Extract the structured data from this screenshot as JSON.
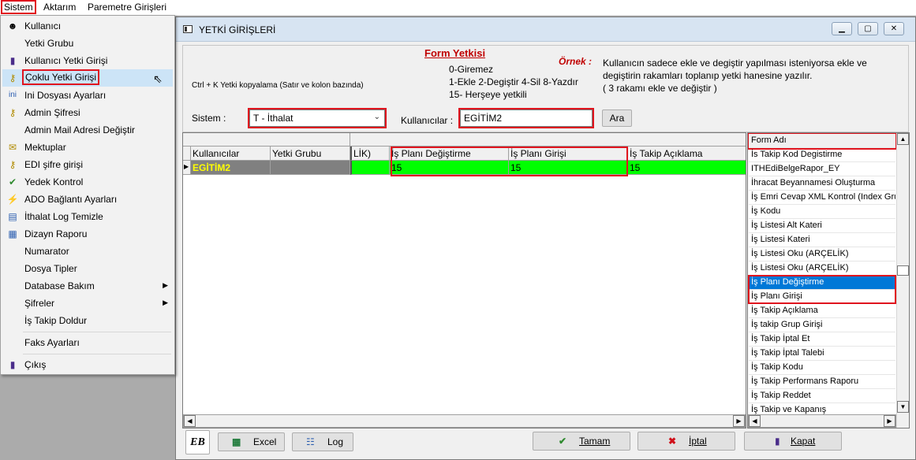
{
  "menubar": {
    "items": [
      "Sistem",
      "Aktarım",
      "Paremetre Girişleri"
    ]
  },
  "menu": {
    "items": [
      {
        "label": "Kullanıcı",
        "icon": "user-icon"
      },
      {
        "label": "Yetki Grubu",
        "icon": ""
      },
      {
        "label": "Kullanıcı Yetki Girişi",
        "icon": "door-icon"
      },
      {
        "label": "Çoklu Yetki Girişi",
        "icon": "key-icon",
        "highlighted": true
      },
      {
        "label": "Ini Dosyası  Ayarları",
        "icon": "ini-file-icon"
      },
      {
        "label": "Admin Şifresi",
        "icon": "key-icon"
      },
      {
        "label": "Admin Mail Adresi Değiştir",
        "icon": ""
      },
      {
        "label": "Mektuplar",
        "icon": "letter-icon"
      },
      {
        "label": "EDI şifre girişi",
        "icon": "key-icon"
      },
      {
        "label": "Yedek Kontrol",
        "icon": "backup-icon"
      },
      {
        "label": "ADO Bağlantı Ayarları",
        "icon": "connection-icon"
      },
      {
        "label": "İthalat Log Temizle",
        "icon": "log-icon"
      },
      {
        "label": "Dizayn Raporu",
        "icon": "report-icon"
      },
      {
        "label": "Numarator",
        "icon": ""
      },
      {
        "label": "Dosya Tipler",
        "icon": ""
      },
      {
        "label": "Database Bakım",
        "icon": "",
        "submenu": true
      },
      {
        "label": "Şifreler",
        "icon": "",
        "submenu": true
      },
      {
        "label": "İş Takip Doldur",
        "icon": ""
      },
      {
        "label": "Faks Ayarları",
        "icon": ""
      },
      {
        "label": "Çıkış",
        "icon": "exit-door-icon"
      }
    ]
  },
  "window": {
    "title": "YETKİ GİRİŞLERİ",
    "form_yetkisi_title": "Form Yetkisi",
    "legend_lines": [
      "0-Giremez",
      "1-Ekle  2-Degiştir  4-Sil  8-Yazdır",
      "15- Herşeye yetkili"
    ],
    "ctrl_hint": "Ctrl + K Yetki kopyalama (Satır ve kolon bazında)",
    "ornek_label": "Örnek :",
    "ornek_text_lines": [
      "Kullanıcın sadece ekle ve degiştir yapılması isteniyorsa  ekle ve",
      "degiştirin rakamları toplanıp yetki hanesine yazılır.",
      " ( 3 rakamı ekle ve değiştir )"
    ],
    "sistem_label": "Sistem :",
    "sistem_value": "T - İthalat",
    "kullanicilar_label": "Kullanıcılar :",
    "kullanicilar_value": "EGİTİM2",
    "ara_button": "Ara"
  },
  "grid": {
    "headers": [
      "Kullanıcılar",
      "Yetki Grubu",
      "LİK)",
      "İş Planı Değiştirme",
      "İş Planı Girişi",
      "İş Takip Açıklama"
    ],
    "row": {
      "user": "EGİTİM2",
      "group": "",
      "col3": "",
      "plan_degistirme": "15",
      "plan_girisi": "15",
      "takip_aciklama": "15"
    }
  },
  "form_list": {
    "header": "Form Adı",
    "items": [
      "İs Takip Kod Degistirme",
      "ITHEdiBelgeRapor_EY",
      "İhracat Beyannamesi Oluşturma",
      "İş Emri Cevap XML Kontrol (Index Grup",
      "İş Kodu",
      "İş Listesi Alt Kateri",
      "İş Listesi Kateri",
      "İş Listesi Oku (ARÇELİK)",
      "İş Listesi Oku (ARÇELİK)",
      "İş Planı Değiştirme",
      "İş Planı Girişi",
      "İş Takip Açıklama",
      "İş takip Grup Girişi",
      "İş Takip İptal Et",
      "İş Takip İptal Talebi",
      "İş Takip Kodu",
      "İş Takip Performans Raporu",
      "İş Takip Reddet",
      "İş Takip ve Kapanış"
    ],
    "selected_index": 9
  },
  "footer": {
    "logo_text": "EB",
    "excel": "Excel",
    "log": "Log",
    "tamam": "Tamam",
    "iptal": "İptal",
    "kapat": "Kapat"
  },
  "colors": {
    "highlight_red": "#e0141e",
    "green_row": "#00ff00",
    "selected_row": "#0078d7",
    "form_title_red": "#c00000"
  }
}
